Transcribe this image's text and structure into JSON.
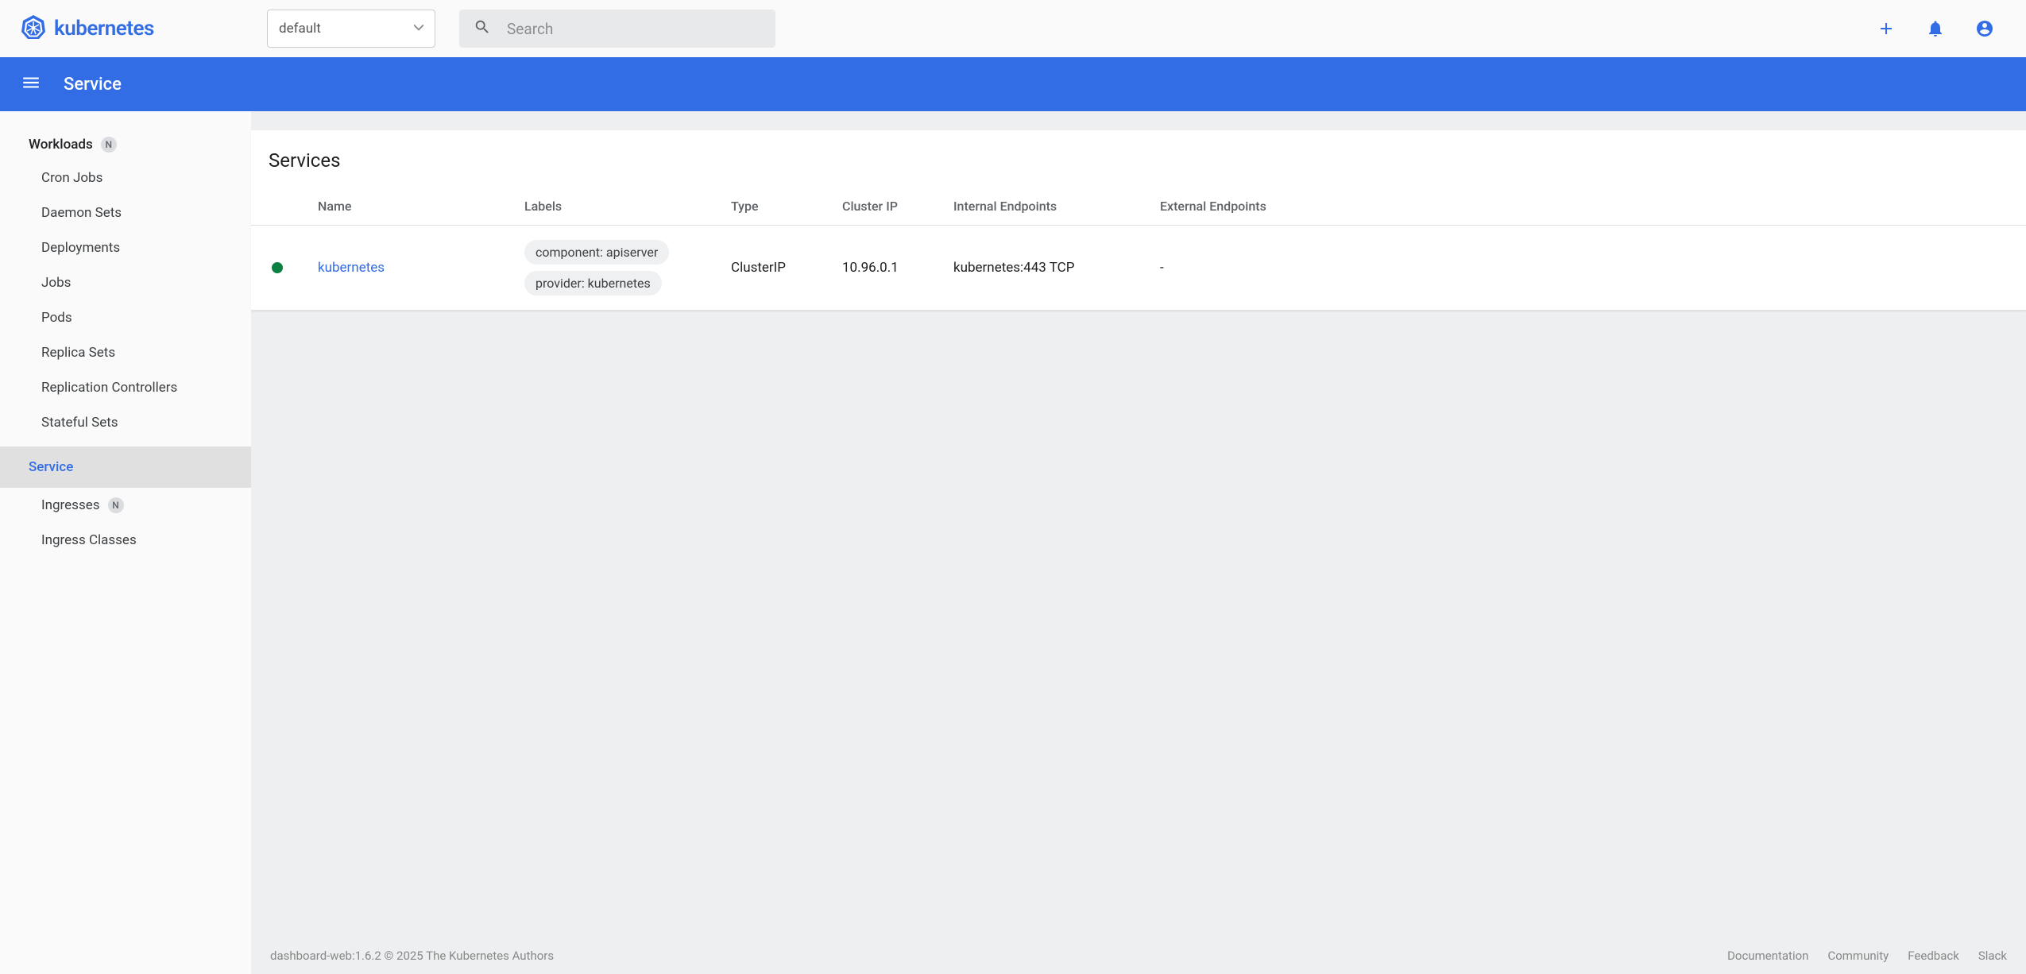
{
  "colors": {
    "accent": "#326de6"
  },
  "topbar": {
    "product_name": "kubernetes",
    "namespace_selected": "default",
    "search_placeholder": "Search",
    "icons": {
      "plus": "add-icon",
      "bell": "notifications-icon",
      "account": "account-circle-icon"
    }
  },
  "bluebar": {
    "title": "Service"
  },
  "sidebar": {
    "sections": [
      {
        "heading": "Workloads",
        "badge": "N",
        "items": [
          {
            "label": "Cron Jobs"
          },
          {
            "label": "Daemon Sets"
          },
          {
            "label": "Deployments"
          },
          {
            "label": "Jobs"
          },
          {
            "label": "Pods"
          },
          {
            "label": "Replica Sets"
          },
          {
            "label": "Replication Controllers"
          },
          {
            "label": "Stateful Sets"
          }
        ]
      },
      {
        "heading": "Service",
        "active": true,
        "items": [
          {
            "label": "Ingresses",
            "badge": "N"
          },
          {
            "label": "Ingress Classes"
          }
        ]
      }
    ]
  },
  "main": {
    "card_title": "Services",
    "columns": {
      "name": "Name",
      "labels": "Labels",
      "type": "Type",
      "cluster_ip": "Cluster IP",
      "internal_endpoints": "Internal Endpoints",
      "external_endpoints": "External Endpoints"
    },
    "rows": [
      {
        "status": "ok",
        "name": "kubernetes",
        "labels": [
          "component: apiserver",
          "provider: kubernetes"
        ],
        "type": "ClusterIP",
        "cluster_ip": "10.96.0.1",
        "internal_endpoints": "kubernetes:443 TCP",
        "external_endpoints": "-"
      }
    ]
  },
  "footer": {
    "version": "dashboard-web:1.6.2 © 2025 The Kubernetes Authors",
    "links": [
      "Documentation",
      "Community",
      "Feedback",
      "Slack"
    ]
  }
}
